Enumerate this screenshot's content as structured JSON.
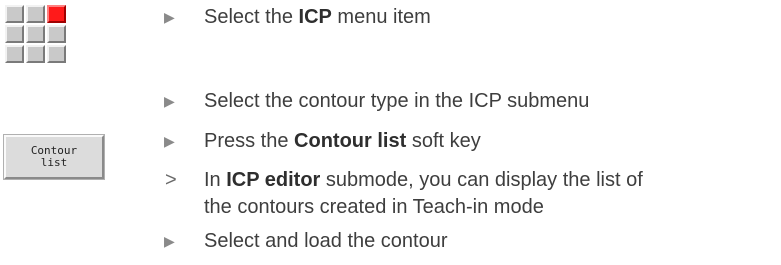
{
  "icp_icon": {
    "name": "icp-menu-grid-icon",
    "active_color": "#ff1a1a"
  },
  "softkey": {
    "line1": "Contour",
    "line2": "list"
  },
  "steps": [
    {
      "marker": "▶",
      "before": "Select the ",
      "bold": "ICP",
      "after": " menu item"
    },
    {
      "marker": "▶",
      "text": "Select the contour type in the ICP submenu"
    },
    {
      "marker": "▶",
      "before": "Press the ",
      "bold": "Contour list",
      "after": " soft key"
    },
    {
      "marker": ">",
      "before": "In ",
      "bold": "ICP editor",
      "after": " submode, you can display the list of",
      "line2": "the contours created in Teach-in mode"
    },
    {
      "marker": "▶",
      "text": "Select and load the contour"
    }
  ]
}
